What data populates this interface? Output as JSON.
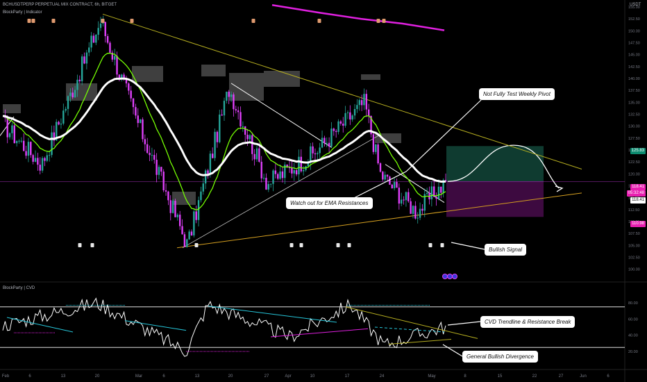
{
  "header": {
    "symbol": "BCHUSDTPERP PERPETUAL MIX CONTRACT, 6h, BITGET",
    "indicator_main": "BlockParty | Indicator",
    "indicator_sub": "BlockParty | CVD",
    "currency": "USDT"
  },
  "colors": {
    "bg": "#000000",
    "candle_up": "#26a69a",
    "candle_down": "#e040fb",
    "ema_white": "#ffffff",
    "ema_green": "#76ff03",
    "trendline": "#b8b020",
    "zone_box": "#4a4a4a",
    "profit_zone": "#0f3b30",
    "loss_zone": "#3d0a40",
    "magenta_line": "#e020e0",
    "cyan_line": "#26c6da"
  },
  "callouts": {
    "weekly_pivot": "Not Fully Test Weekly Pivot",
    "ema_resist": "Watch out for EMA Resistances",
    "bullish_signal": "Bullish Signal",
    "cvd_break": "CVD Trendline & Resistance Break",
    "bull_div": "General Bullish Divergence"
  },
  "price_tags": {
    "target": "125.83",
    "current": "118.41",
    "timer": "05:32:48",
    "entry": "118.41",
    "stop": "110.98"
  },
  "chart_data": [
    {
      "type": "candlestick",
      "title": "BCHUSDTPERP PERPETUAL MIX CONTRACT, 6h, BITGET",
      "ylim": [
        98.5,
        155
      ],
      "y_ticks": [
        100.0,
        102.5,
        105.0,
        107.5,
        110.0,
        112.5,
        115.0,
        117.5,
        120.0,
        122.5,
        125.0,
        127.5,
        130.0,
        132.5,
        135.0,
        137.5,
        140.0,
        142.5,
        145.0,
        147.5,
        150.0,
        152.5,
        155.0
      ],
      "x_ticks": [
        "Feb",
        "6",
        "13",
        "20",
        "Mar",
        "6",
        "13",
        "20",
        "27",
        "Apr",
        "10",
        "17",
        "24",
        "May",
        "8",
        "15",
        "22",
        "27",
        "Jun",
        "6"
      ],
      "price_key_points": [
        {
          "x": "Feb 1",
          "y": 130.5
        },
        {
          "x": "Feb 10",
          "y": 122
        },
        {
          "x": "Feb 18",
          "y": 152
        },
        {
          "x": "Feb 27",
          "y": 132
        },
        {
          "x": "Mar 11",
          "y": 105
        },
        {
          "x": "Mar 21",
          "y": 138
        },
        {
          "x": "Mar 29",
          "y": 118
        },
        {
          "x": "Apr 12",
          "y": 124
        },
        {
          "x": "Apr 17",
          "y": 135
        },
        {
          "x": "Apr 23",
          "y": 120
        },
        {
          "x": "Apr 25",
          "y": 112
        },
        {
          "x": "May 1",
          "y": 118.4
        }
      ],
      "position": {
        "entry": 118.41,
        "target": 125.83,
        "stop": 110.98
      },
      "signals": {
        "bearish_markers": 8,
        "bullish_markers": 8
      }
    },
    {
      "type": "line",
      "title": "BlockParty | CVD",
      "ylim": [
        8,
        92
      ],
      "y_ticks": [
        20.0,
        40.0,
        60.0,
        80.0
      ],
      "levels": [
        25,
        75
      ],
      "cvd_key_points": [
        {
          "x": "Feb 1",
          "y": 52
        },
        {
          "x": "Feb 20",
          "y": 80
        },
        {
          "x": "Mar 9",
          "y": 20
        },
        {
          "x": "Mar 18",
          "y": 78
        },
        {
          "x": "Apr 6",
          "y": 38
        },
        {
          "x": "Apr 17",
          "y": 78
        },
        {
          "x": "Apr 24",
          "y": 28
        },
        {
          "x": "May 2",
          "y": 50
        }
      ]
    }
  ]
}
